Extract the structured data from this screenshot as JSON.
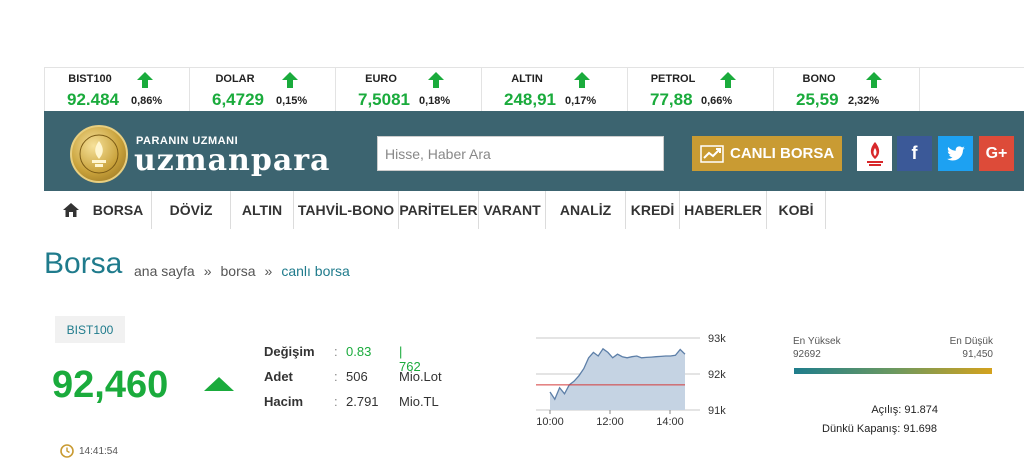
{
  "ticker": [
    {
      "name": "BIST100",
      "value": "92.484",
      "change": "0,86%"
    },
    {
      "name": "DOLAR",
      "value": "6,4729",
      "change": "0,15%"
    },
    {
      "name": "EURO",
      "value": "7,5081",
      "change": "0,18%"
    },
    {
      "name": "ALTIN",
      "value": "248,91",
      "change": "0,17%"
    },
    {
      "name": "PETROL",
      "value": "77,88",
      "change": "0,66%"
    },
    {
      "name": "BONO",
      "value": "25,59",
      "change": "2,32%"
    }
  ],
  "header": {
    "slogan": "PARANIN UZMANI",
    "brand": "uzmanpara",
    "search_placeholder": "Hisse, Haber Ara",
    "live_button": "CANLI BORSA",
    "social": {
      "facebook": "f",
      "twitter": "t",
      "google": "G+"
    }
  },
  "nav": [
    "BORSA",
    "DÖVİZ",
    "ALTIN",
    "TAHVİL-BONO",
    "PARİTELER",
    "VARANT",
    "ANALİZ",
    "KREDİ",
    "HABERLER",
    "KOBİ"
  ],
  "page": {
    "title": "Borsa",
    "breadcrumb": [
      "ana sayfa",
      "borsa",
      "canlı borsa"
    ],
    "breadcrumb_sep": "»"
  },
  "quote": {
    "symbol": "BIST100",
    "price": "92,460",
    "time": "14:41:54",
    "stats": [
      {
        "label": "Değişim",
        "value": "0.83",
        "extra": "| 762"
      },
      {
        "label": "Adet",
        "value": "506",
        "extra": "Mio.Lot"
      },
      {
        "label": "Hacim",
        "value": "2.791",
        "extra": "Mio.TL"
      }
    ],
    "stat_colon": ":"
  },
  "chart_data": {
    "type": "area",
    "x_ticks": [
      "10:00",
      "12:00",
      "14:00"
    ],
    "y_ticks": [
      "93k",
      "92k",
      "91k"
    ],
    "ylim": [
      91000,
      93000
    ],
    "reference_value": 91698,
    "series": [
      {
        "values": [
          91500,
          91300,
          91620,
          91450,
          91700,
          91800,
          91950,
          92150,
          92450,
          92600,
          92500,
          92700,
          92600,
          92450,
          92550,
          92480,
          92450,
          92480,
          92500,
          92450,
          92460,
          92470,
          92480,
          92490,
          92500,
          92500,
          92520,
          92680,
          92550
        ]
      }
    ]
  },
  "range": {
    "high_label": "En Yüksek",
    "high_value": "92692",
    "low_label": "En Düşük",
    "low_value": "91,450",
    "open": "Açılış: 91.874",
    "prev_close": "Dünkü Kapanış: 91.698"
  },
  "colors": {
    "band": "#3c6470",
    "up": "#1aab3c",
    "accent": "#1f7b8c",
    "live": "#c99b33",
    "facebook": "#3b5998",
    "twitter": "#1da1f2",
    "google": "#dd4b39"
  }
}
